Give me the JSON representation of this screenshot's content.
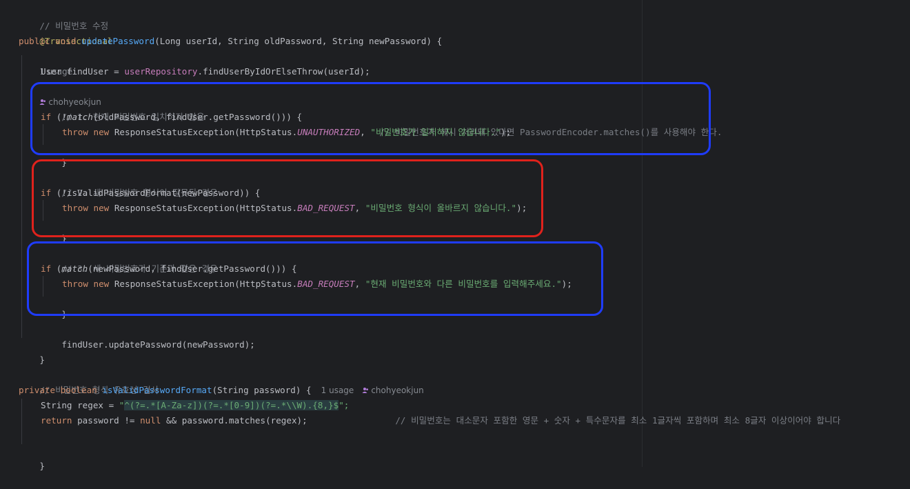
{
  "code": {
    "comment_change_password": "// 비밀번호 수정",
    "annotation": "@Transactional",
    "usage_hint_1": "1 usage",
    "author_hint_1": "chohyeokjun",
    "kw_public": "public",
    "kw_void": "void",
    "method_update": "updatePassword",
    "params_update": "(Long userId, String oldPassword, String newPassword) {",
    "find_user_prefix": "User findUser = ",
    "user_repo": "userRepository",
    "find_user_suffix": ".findUserByIdOrElseThrow(userId);",
    "comment_1": "// 1. 현재 비밀번호 일치하지 않음",
    "if_kw": "if",
    "cond1_a": " (!",
    "match_fn": "match",
    "cond1_b": "(oldPassword, findUser.getPassword())) {",
    "trailing_comment_1": "// 비밀번호가 해시 처리돼 있다면 PasswordEncoder.matches()를 사용해야 한다.",
    "throw_kw": "throw",
    "new_kw": "new",
    "exception_call": " ResponseStatusException(HttpStatus.",
    "const_unauthorized": "UNAUTHORIZED",
    "msg_1": "\"비밀번호가 일치하지 않습니다.\"",
    "close_call": ");",
    "close_brace": "}",
    "comment_2": "// 2. 새 비밀번호 형식이 잘못된 경우",
    "cond2": " (!isValidPasswordFormat(newPassword)) {",
    "const_bad_request": "BAD_REQUEST",
    "msg_2": "\"비밀번호 형식이 올바르지 않습니다.\"",
    "comment_3": "// 3. 새 비밀번호가 기존과 같은 경우",
    "cond3_a": " (",
    "cond3_b": "(newPassword, findUser.getPassword())) {",
    "msg_3": "\"현재 비밀번호와 다른 비밀번호를 입력해주세요.\"",
    "update_call": "findUser.updatePassword(newPassword);",
    "comment_validate": "// 비밀번호 형식 유효성 검사",
    "kw_private": "private",
    "kw_boolean": "boolean",
    "method_valid": "isValidPasswordFormat",
    "params_valid": "(String password) {",
    "usage_hint_2": "1 usage",
    "author_hint_2": "chohyeokjun",
    "regex_decl": "String regex = ",
    "regex_q1": "\"",
    "regex_value": "^(?=.*[A-Za-z])(?=.*[0-9])(?=.*\\\\W).{8,}$",
    "regex_q2": "\";",
    "regex_comment": "// 비밀번호는 대소문자 포함한 영문 + 숫자 + 특수문자를 최소 1글자씩 포함하며 최소 8글자 이상이어야 합니다",
    "return_kw": "return",
    "return_expr_a": " password != ",
    "null_kw": "null",
    "return_expr_b": " && password.matches(regex);"
  },
  "colors": {
    "background": "#1e1f22",
    "box_blue": "#1f3cff",
    "box_red": "#e0221c"
  }
}
